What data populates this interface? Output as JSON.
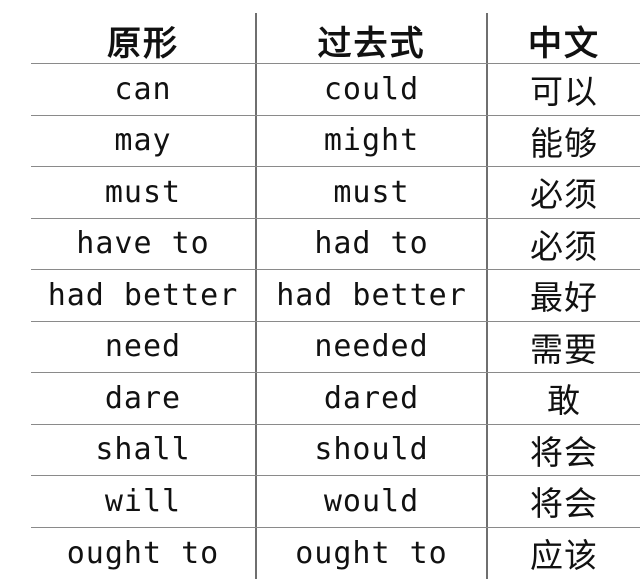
{
  "table": {
    "headers": [
      "原形",
      "过去式",
      "中文"
    ],
    "rows": [
      [
        "can",
        "could",
        "可以"
      ],
      [
        "may",
        "might",
        "能够"
      ],
      [
        "must",
        "must",
        "必须"
      ],
      [
        "have to",
        "had to",
        "必须"
      ],
      [
        "had better",
        "had better",
        "最好"
      ],
      [
        "need",
        "needed",
        "需要"
      ],
      [
        "dare",
        "dared",
        "敢"
      ],
      [
        "shall",
        "should",
        "将会"
      ],
      [
        "will",
        "would",
        "将会"
      ],
      [
        "ought to",
        "ought to",
        "应该"
      ]
    ]
  }
}
